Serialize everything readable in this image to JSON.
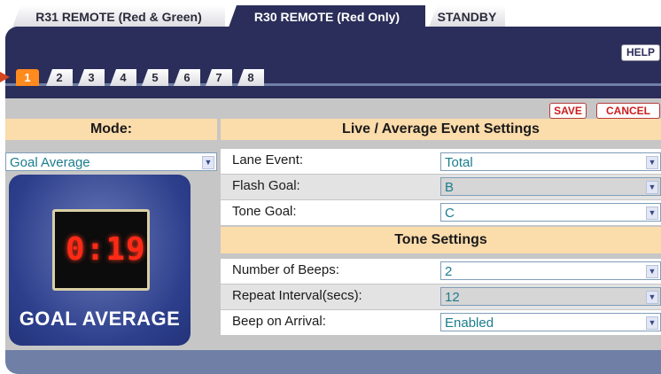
{
  "top_tabs": [
    {
      "label": "R31 REMOTE (Red & Green)",
      "active": false
    },
    {
      "label": "R30 REMOTE (Red Only)",
      "active": true
    },
    {
      "label": "STANDBY",
      "active": false
    }
  ],
  "help_label": "HELP",
  "number_tabs": [
    "1",
    "2",
    "3",
    "4",
    "5",
    "6",
    "7",
    "8"
  ],
  "active_number_tab": "1",
  "actions": {
    "save": "SAVE",
    "cancel": "CANCEL"
  },
  "mode": {
    "header": "Mode:",
    "value": "Goal Average",
    "image": {
      "display": "0:19",
      "caption": "GOAL AVERAGE"
    }
  },
  "live_settings": {
    "header": "Live / Average Event Settings",
    "rows": [
      {
        "label": "Lane Event:",
        "value": "Total"
      },
      {
        "label": "Flash Goal:",
        "value": "B"
      },
      {
        "label": "Tone Goal:",
        "value": "C"
      }
    ]
  },
  "tone_settings": {
    "header": "Tone Settings",
    "rows": [
      {
        "label": "Number of Beeps:",
        "value": "2"
      },
      {
        "label": "Repeat Interval(secs):",
        "value": "12"
      },
      {
        "label": "Beep on Arrival:",
        "value": "Enabled"
      }
    ]
  },
  "colors": {
    "navy": "#2b2e5a",
    "panel": "#6f7fa6",
    "accent": "#ff8a1e",
    "header_bg": "#fbdcab",
    "value_text": "#1a7d8e"
  }
}
